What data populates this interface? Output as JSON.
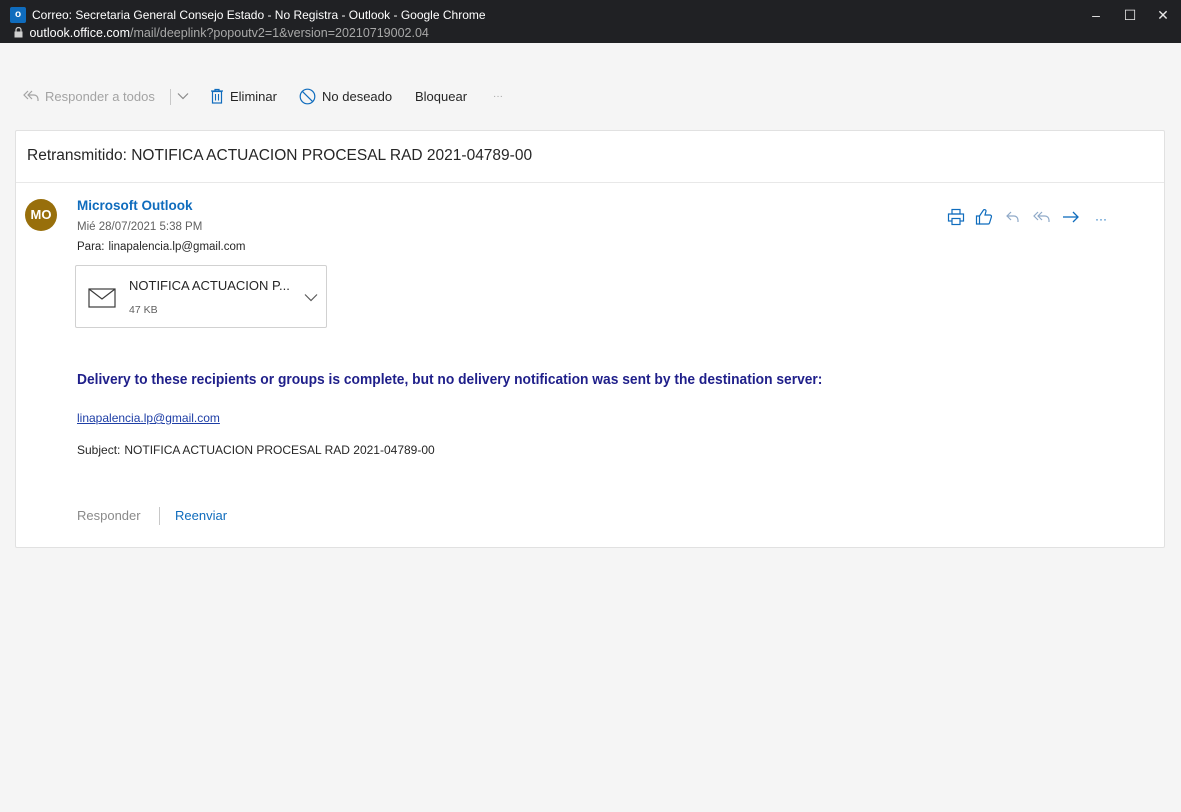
{
  "window": {
    "title": "Correo: Secretaria General Consejo Estado - No Registra - Outlook - Google Chrome",
    "url_host": "outlook.office.com",
    "url_path": "/mail/deeplink?popoutv2=1&version=20210719002.04",
    "minimize": "–",
    "maximize": "☐",
    "close": "✕"
  },
  "toolbar": {
    "reply_all": "Responder a todos",
    "delete": "Eliminar",
    "junk": "No deseado",
    "block": "Bloquear",
    "more": "···"
  },
  "message": {
    "subject": "Retransmitido: NOTIFICA ACTUACION PROCESAL RAD 2021-04789-00",
    "avatar_initials": "MO",
    "sender": "Microsoft Outlook",
    "date": "Mié 28/07/2021 5:38 PM",
    "to_label": "Para:",
    "to_value": "linapalencia.lp@gmail.com",
    "more_actions": "···",
    "attachment": {
      "name": "NOTIFICA ACTUACION P...",
      "size": "47 KB"
    },
    "body": {
      "heading": "Delivery to these recipients or groups is complete, but no delivery notification was sent by the destination server:",
      "recipient_link": "linapalencia.lp@gmail.com",
      "subject_label": "Subject:",
      "subject_value": "NOTIFICA ACTUACION PROCESAL RAD 2021-04789-00"
    },
    "reply_label": "Responder",
    "forward_label": "Reenviar"
  },
  "colors": {
    "accent": "#0f6cbd",
    "avatar_bg": "#986f0b",
    "heading_text": "#1f1f8a",
    "titlebar_bg": "#202124"
  }
}
